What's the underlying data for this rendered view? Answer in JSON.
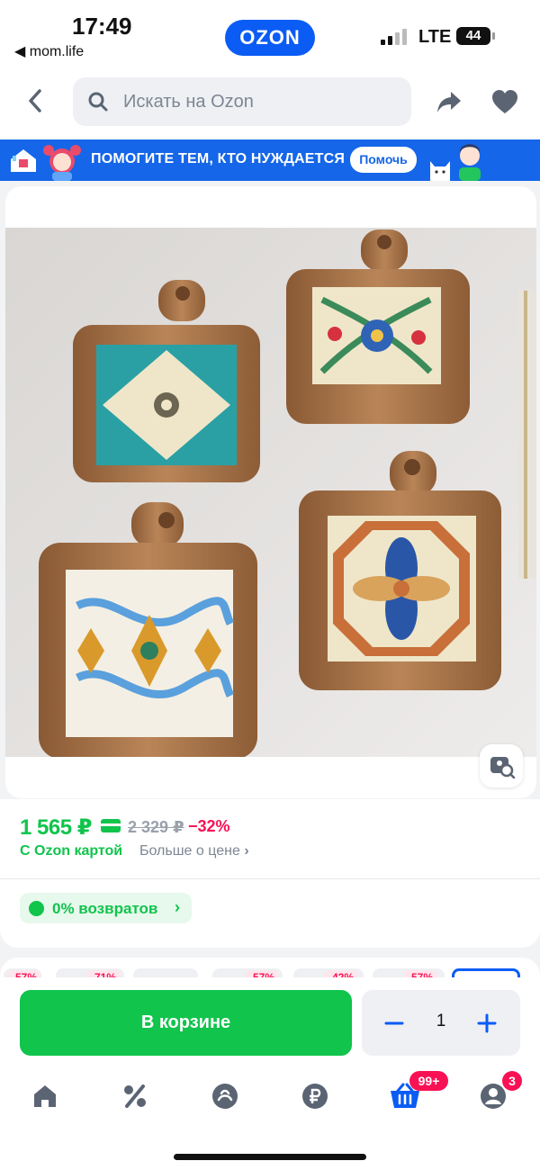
{
  "status_bar": {
    "time": "17:49",
    "back_app": "◀ mom.life",
    "center_brand": "OZON",
    "network": "LTE",
    "battery": "44"
  },
  "header": {
    "search_placeholder": "Искать на Ozon",
    "icons": [
      "chevron-left-icon",
      "search-icon",
      "share-icon",
      "heart-icon"
    ]
  },
  "banner": {
    "text": "ПОМОГИТЕ ТЕМ, КТО НУЖДАЕТСЯ",
    "button": "Помочь"
  },
  "product": {
    "price": "1 565 ₽",
    "old_price": "2 329 ₽",
    "discount": "−32%",
    "card_label": "С Ozon картой",
    "more_price": "Больше о цене",
    "returns_label": "0% возвратов"
  },
  "teaser_strip": {
    "discounts": [
      "-57%",
      "-71%",
      "-57%",
      "-42%",
      "-57%"
    ]
  },
  "cart_bar": {
    "add_to_cart": "В корзине",
    "quantity": "1"
  },
  "tab_bar": {
    "items": [
      "home-icon",
      "percent-icon",
      "brand-icon",
      "ruble-icon",
      "cart-icon",
      "profile-icon"
    ],
    "cart_badge": "99+",
    "profile_badge": "3"
  },
  "colors": {
    "accent_blue": "#0a5cf5",
    "price_green": "#10c44c",
    "discount_red": "#f91155",
    "banner_blue": "#1566e8"
  }
}
